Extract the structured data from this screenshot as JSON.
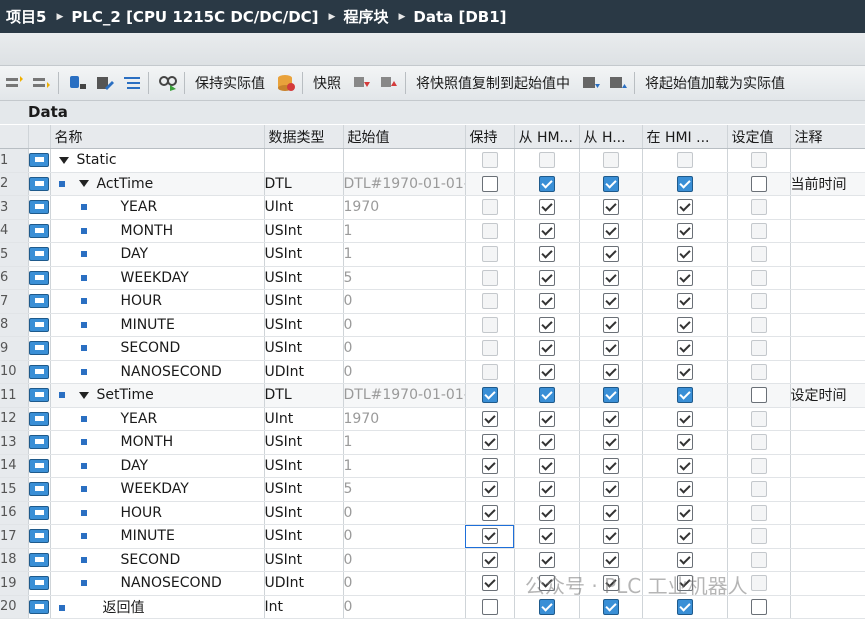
{
  "breadcrumb": [
    "项目5",
    "PLC_2 [CPU 1215C DC/DC/DC]",
    "程序块",
    "Data [DB1]"
  ],
  "toolbar": {
    "keep_actual": "保持实际值",
    "snapshot": "快照",
    "copy_snapshot": "将快照值复制到起始值中",
    "load_start": "将起始值加载为实际值"
  },
  "db_title": "Data",
  "columns": [
    "名称",
    "数据类型",
    "起始值",
    "保持",
    "从 HM...",
    "从 H...",
    "在 HMI ...",
    "设定值",
    "注释"
  ],
  "rows": [
    {
      "num": "1",
      "name": "Static",
      "type": "",
      "start": "",
      "keep": "off_dis",
      "hmi1": "off_dis",
      "hmi2": "off_dis",
      "hmi3": "off_dis",
      "setp": "off_dis",
      "comment": ""
    },
    {
      "num": "2",
      "name": "ActTime",
      "type": "DTL",
      "start": "DTL#1970-01-01-",
      "keep": "off",
      "hmi1": "blue",
      "hmi2": "blue",
      "hmi3": "blue",
      "setp": "off",
      "comment": "当前时间"
    },
    {
      "num": "3",
      "name": "YEAR",
      "type": "UInt",
      "start": "1970",
      "keep": "off_dis",
      "hmi1": "on",
      "hmi2": "on",
      "hmi3": "on",
      "setp": "off_dis",
      "comment": ""
    },
    {
      "num": "4",
      "name": "MONTH",
      "type": "USInt",
      "start": "1",
      "keep": "off_dis",
      "hmi1": "on",
      "hmi2": "on",
      "hmi3": "on",
      "setp": "off_dis",
      "comment": ""
    },
    {
      "num": "5",
      "name": "DAY",
      "type": "USInt",
      "start": "1",
      "keep": "off_dis",
      "hmi1": "on",
      "hmi2": "on",
      "hmi3": "on",
      "setp": "off_dis",
      "comment": ""
    },
    {
      "num": "6",
      "name": "WEEKDAY",
      "type": "USInt",
      "start": "5",
      "keep": "off_dis",
      "hmi1": "on",
      "hmi2": "on",
      "hmi3": "on",
      "setp": "off_dis",
      "comment": ""
    },
    {
      "num": "7",
      "name": "HOUR",
      "type": "USInt",
      "start": "0",
      "keep": "off_dis",
      "hmi1": "on",
      "hmi2": "on",
      "hmi3": "on",
      "setp": "off_dis",
      "comment": ""
    },
    {
      "num": "8",
      "name": "MINUTE",
      "type": "USInt",
      "start": "0",
      "keep": "off_dis",
      "hmi1": "on",
      "hmi2": "on",
      "hmi3": "on",
      "setp": "off_dis",
      "comment": ""
    },
    {
      "num": "9",
      "name": "SECOND",
      "type": "USInt",
      "start": "0",
      "keep": "off_dis",
      "hmi1": "on",
      "hmi2": "on",
      "hmi3": "on",
      "setp": "off_dis",
      "comment": ""
    },
    {
      "num": "10",
      "name": "NANOSECOND",
      "type": "UDInt",
      "start": "0",
      "keep": "off_dis",
      "hmi1": "on",
      "hmi2": "on",
      "hmi3": "on",
      "setp": "off_dis",
      "comment": ""
    },
    {
      "num": "11",
      "name": "SetTime",
      "type": "DTL",
      "start": "DTL#1970-01-01-",
      "keep": "blue",
      "hmi1": "blue",
      "hmi2": "blue",
      "hmi3": "blue",
      "setp": "off",
      "comment": "设定时间"
    },
    {
      "num": "12",
      "name": "YEAR",
      "type": "UInt",
      "start": "1970",
      "keep": "on",
      "hmi1": "on",
      "hmi2": "on",
      "hmi3": "on",
      "setp": "off_dis",
      "comment": ""
    },
    {
      "num": "13",
      "name": "MONTH",
      "type": "USInt",
      "start": "1",
      "keep": "on",
      "hmi1": "on",
      "hmi2": "on",
      "hmi3": "on",
      "setp": "off_dis",
      "comment": ""
    },
    {
      "num": "14",
      "name": "DAY",
      "type": "USInt",
      "start": "1",
      "keep": "on",
      "hmi1": "on",
      "hmi2": "on",
      "hmi3": "on",
      "setp": "off_dis",
      "comment": ""
    },
    {
      "num": "15",
      "name": "WEEKDAY",
      "type": "USInt",
      "start": "5",
      "keep": "on",
      "hmi1": "on",
      "hmi2": "on",
      "hmi3": "on",
      "setp": "off_dis",
      "comment": ""
    },
    {
      "num": "16",
      "name": "HOUR",
      "type": "USInt",
      "start": "0",
      "keep": "on",
      "hmi1": "on",
      "hmi2": "on",
      "hmi3": "on",
      "setp": "off_dis",
      "comment": ""
    },
    {
      "num": "17",
      "name": "MINUTE",
      "type": "USInt",
      "start": "0",
      "keep": "on_sel",
      "hmi1": "on",
      "hmi2": "on",
      "hmi3": "on",
      "setp": "off_dis",
      "comment": ""
    },
    {
      "num": "18",
      "name": "SECOND",
      "type": "USInt",
      "start": "0",
      "keep": "on",
      "hmi1": "on",
      "hmi2": "on",
      "hmi3": "on",
      "setp": "off_dis",
      "comment": ""
    },
    {
      "num": "19",
      "name": "NANOSECOND",
      "type": "UDInt",
      "start": "0",
      "keep": "on",
      "hmi1": "on",
      "hmi2": "on",
      "hmi3": "on",
      "setp": "off_dis",
      "comment": ""
    },
    {
      "num": "20",
      "name": "返回值",
      "type": "Int",
      "start": "0",
      "keep": "off",
      "hmi1": "blue",
      "hmi2": "blue",
      "hmi3": "blue",
      "setp": "off",
      "comment": ""
    }
  ],
  "watermark": "公众号 · PLC 工业机器人"
}
